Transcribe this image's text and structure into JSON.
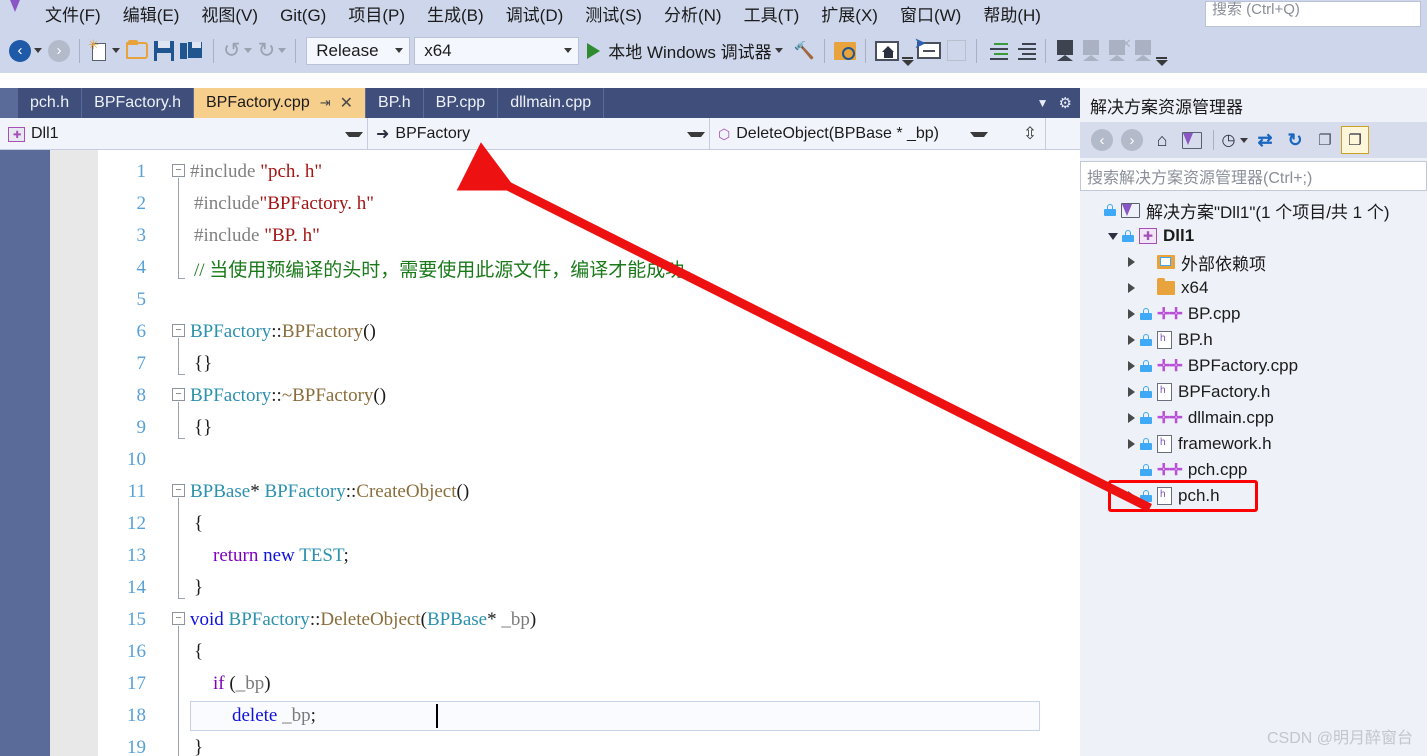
{
  "menu": {
    "items": [
      {
        "label": "文件(F)"
      },
      {
        "label": "编辑(E)"
      },
      {
        "label": "视图(V)"
      },
      {
        "label": "Git(G)"
      },
      {
        "label": "项目(P)"
      },
      {
        "label": "生成(B)"
      },
      {
        "label": "调试(D)"
      },
      {
        "label": "测试(S)"
      },
      {
        "label": "分析(N)"
      },
      {
        "label": "工具(T)"
      },
      {
        "label": "扩展(X)"
      },
      {
        "label": "窗口(W)"
      },
      {
        "label": "帮助(H)"
      }
    ],
    "search_placeholder": "搜索 (Ctrl+Q)"
  },
  "toolbar": {
    "configuration": "Release",
    "platform": "x64",
    "run_label": "本地 Windows 调试器",
    "icons": [
      "navigate-back-icon",
      "navigate-forward-icon",
      "new-item-icon",
      "open-file-icon",
      "save-icon",
      "save-all-icon",
      "undo-icon",
      "redo-icon",
      "hammer-icon",
      "find-in-files-icon",
      "preview-home-icon",
      "cursor-select-icon",
      "copy-lines-icon",
      "indent-increase-icon",
      "comment-icon",
      "bookmark-icon",
      "previous-bookmark-icon",
      "next-bookmark-icon",
      "clear-bookmarks-icon"
    ]
  },
  "tabs": {
    "items": [
      {
        "label": "pch.h",
        "active": false
      },
      {
        "label": "BPFactory.h",
        "active": false
      },
      {
        "label": "BPFactory.cpp",
        "active": true
      },
      {
        "label": "BP.h",
        "active": false
      },
      {
        "label": "BP.cpp",
        "active": false
      },
      {
        "label": "dllmain.cpp",
        "active": false
      }
    ],
    "pin_glyph": "⇥",
    "close_glyph": "✕"
  },
  "navbar": {
    "project": "Dll1",
    "type": "BPFactory",
    "member": "DeleteObject(BPBase * _bp)"
  },
  "editor": {
    "lines": [
      {
        "n": "1",
        "fold": "minus",
        "indent": 0,
        "tokens": [
          {
            "t": "#include ",
            "c": "pp"
          },
          {
            "t": "\"pch. h\"",
            "c": "str"
          }
        ]
      },
      {
        "n": "2",
        "fold": "",
        "indent": 1,
        "tokens": [
          {
            "t": "#include",
            "c": "pp"
          },
          {
            "t": "\"BPFactory. h\"",
            "c": "str"
          }
        ]
      },
      {
        "n": "3",
        "fold": "",
        "indent": 1,
        "tokens": [
          {
            "t": "#include ",
            "c": "pp"
          },
          {
            "t": "\"BP. h\"",
            "c": "str"
          }
        ]
      },
      {
        "n": "4",
        "fold": "",
        "indent": 1,
        "tokens": [
          {
            "t": "// 当使用预编译的头时，需要使用此源文件，编译才能成功。",
            "c": "cmt"
          }
        ]
      },
      {
        "n": "5",
        "fold": "",
        "indent": 0,
        "tokens": []
      },
      {
        "n": "6",
        "fold": "minus",
        "indent": 0,
        "tokens": [
          {
            "t": "BPFactory",
            "c": "type"
          },
          {
            "t": "::",
            "c": "pln"
          },
          {
            "t": "BPFactory",
            "c": "fn"
          },
          {
            "t": "()",
            "c": "pln"
          }
        ]
      },
      {
        "n": "7",
        "fold": "",
        "indent": 1,
        "tokens": [
          {
            "t": "{}",
            "c": "pln"
          }
        ]
      },
      {
        "n": "8",
        "fold": "minus",
        "indent": 0,
        "tokens": [
          {
            "t": "BPFactory",
            "c": "type"
          },
          {
            "t": "::",
            "c": "pln"
          },
          {
            "t": "~BPFactory",
            "c": "fn"
          },
          {
            "t": "()",
            "c": "pln"
          }
        ]
      },
      {
        "n": "9",
        "fold": "",
        "indent": 1,
        "tokens": [
          {
            "t": "{}",
            "c": "pln"
          }
        ]
      },
      {
        "n": "10",
        "fold": "",
        "indent": 0,
        "tokens": []
      },
      {
        "n": "11",
        "fold": "minus",
        "indent": 0,
        "tokens": [
          {
            "t": "BPBase",
            "c": "type"
          },
          {
            "t": "* ",
            "c": "pln"
          },
          {
            "t": "BPFactory",
            "c": "type"
          },
          {
            "t": "::",
            "c": "pln"
          },
          {
            "t": "CreateObject",
            "c": "fn"
          },
          {
            "t": "()",
            "c": "pln"
          }
        ]
      },
      {
        "n": "12",
        "fold": "",
        "indent": 1,
        "tokens": [
          {
            "t": "{",
            "c": "pln"
          }
        ]
      },
      {
        "n": "13",
        "fold": "",
        "indent": 2,
        "tokens": [
          {
            "t": "    return",
            "c": "kw2"
          },
          {
            "t": " new ",
            "c": "kw"
          },
          {
            "t": "TEST",
            "c": "type"
          },
          {
            "t": ";",
            "c": "pln"
          }
        ]
      },
      {
        "n": "14",
        "fold": "",
        "indent": 1,
        "tokens": [
          {
            "t": "}",
            "c": "pln"
          }
        ]
      },
      {
        "n": "15",
        "fold": "minus",
        "indent": 0,
        "tokens": [
          {
            "t": "void ",
            "c": "kw"
          },
          {
            "t": "BPFactory",
            "c": "type"
          },
          {
            "t": "::",
            "c": "pln"
          },
          {
            "t": "DeleteObject",
            "c": "fn"
          },
          {
            "t": "(",
            "c": "pln"
          },
          {
            "t": "BPBase",
            "c": "type"
          },
          {
            "t": "* ",
            "c": "pln"
          },
          {
            "t": "_bp",
            "c": "var"
          },
          {
            "t": ")",
            "c": "pln"
          }
        ]
      },
      {
        "n": "16",
        "fold": "",
        "indent": 1,
        "tokens": [
          {
            "t": "{",
            "c": "pln"
          }
        ]
      },
      {
        "n": "17",
        "fold": "",
        "indent": 2,
        "tokens": [
          {
            "t": "    if",
            "c": "kw2"
          },
          {
            "t": " (",
            "c": "pln"
          },
          {
            "t": "_bp",
            "c": "var"
          },
          {
            "t": ")",
            "c": "pln"
          }
        ]
      },
      {
        "n": "18",
        "fold": "",
        "indent": 2,
        "tokens": [
          {
            "t": "        delete",
            "c": "kw"
          },
          {
            "t": " ",
            "c": "pln"
          },
          {
            "t": "_bp",
            "c": "var"
          },
          {
            "t": ";",
            "c": "pln"
          }
        ],
        "current": true
      },
      {
        "n": "19",
        "fold": "",
        "indent": 1,
        "tokens": [
          {
            "t": "}",
            "c": "pln"
          }
        ]
      }
    ]
  },
  "solution_explorer": {
    "title": "解决方案资源管理器",
    "search_placeholder": "搜索解决方案资源管理器(Ctrl+;)",
    "toolbar_icons": [
      "back-icon",
      "forward-icon",
      "home-icon",
      "vs-code-view-icon",
      "pending-changes-icon",
      "sync-icon",
      "refresh-icon",
      "collapse-all-icon",
      "show-all-files-icon"
    ],
    "tree": [
      {
        "label": "解决方案\"Dll1\"(1 个项目/共 1 个)",
        "depth": 0,
        "expander": "none",
        "lock": true,
        "icon": "solution-icon",
        "bold": false
      },
      {
        "label": "Dll1",
        "depth": 1,
        "expander": "down",
        "lock": true,
        "icon": "project-icon",
        "bold": true
      },
      {
        "label": "外部依赖项",
        "depth": 2,
        "expander": "right",
        "lock": false,
        "icon": "folder-ref-icon",
        "bold": false
      },
      {
        "label": "x64",
        "depth": 2,
        "expander": "right",
        "lock": false,
        "icon": "folder-icon",
        "bold": false
      },
      {
        "label": "BP.cpp",
        "depth": 2,
        "expander": "right",
        "lock": true,
        "icon": "cpp-file-icon",
        "bold": false
      },
      {
        "label": "BP.h",
        "depth": 2,
        "expander": "right",
        "lock": true,
        "icon": "h-file-icon",
        "bold": false
      },
      {
        "label": "BPFactory.cpp",
        "depth": 2,
        "expander": "right",
        "lock": true,
        "icon": "cpp-file-icon",
        "bold": false
      },
      {
        "label": "BPFactory.h",
        "depth": 2,
        "expander": "right",
        "lock": true,
        "icon": "h-file-icon",
        "bold": false
      },
      {
        "label": "dllmain.cpp",
        "depth": 2,
        "expander": "right",
        "lock": true,
        "icon": "cpp-file-icon",
        "bold": false
      },
      {
        "label": "framework.h",
        "depth": 2,
        "expander": "right",
        "lock": true,
        "icon": "h-file-icon",
        "bold": false
      },
      {
        "label": "pch.cpp",
        "depth": 2,
        "expander": "none",
        "lock": true,
        "icon": "cpp-file-icon",
        "bold": false
      },
      {
        "label": "pch.h",
        "depth": 2,
        "expander": "right",
        "lock": true,
        "icon": "h-file-icon",
        "bold": false,
        "highlighted": true
      }
    ]
  },
  "annotation": {
    "arrow_color": "#ee1111",
    "highlight_color": "#ff0000"
  },
  "watermark": "CSDN @明月醉窗台"
}
